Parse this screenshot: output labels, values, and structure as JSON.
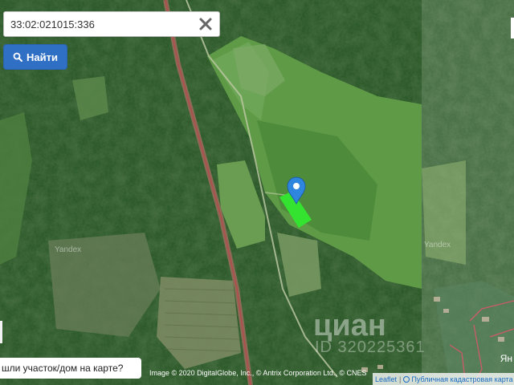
{
  "search": {
    "value": "33:02:021015:336",
    "placeholder": "",
    "button_label": "Найти"
  },
  "map": {
    "watermarks": {
      "yandex": "Yandex",
      "cian_logo": "циан",
      "cian_id": "ID 320225361"
    },
    "corner_label": "Ян",
    "marker_color": "#2e86de",
    "parcel_color": "#34e32f"
  },
  "feedback_text": "шли участок/дом на карте?",
  "attribution": {
    "imagery": "Image © 2020 DigitalGlobe, Inc., © Antrix Corporation Ltd., © CNES",
    "leaflet": "Leaflet",
    "cadastral": "Публичная кадастровая карта"
  },
  "icons": {
    "clear": "close-icon",
    "search": "search-icon",
    "marker": "map-pin-icon",
    "cadastral": "globe-icon"
  }
}
